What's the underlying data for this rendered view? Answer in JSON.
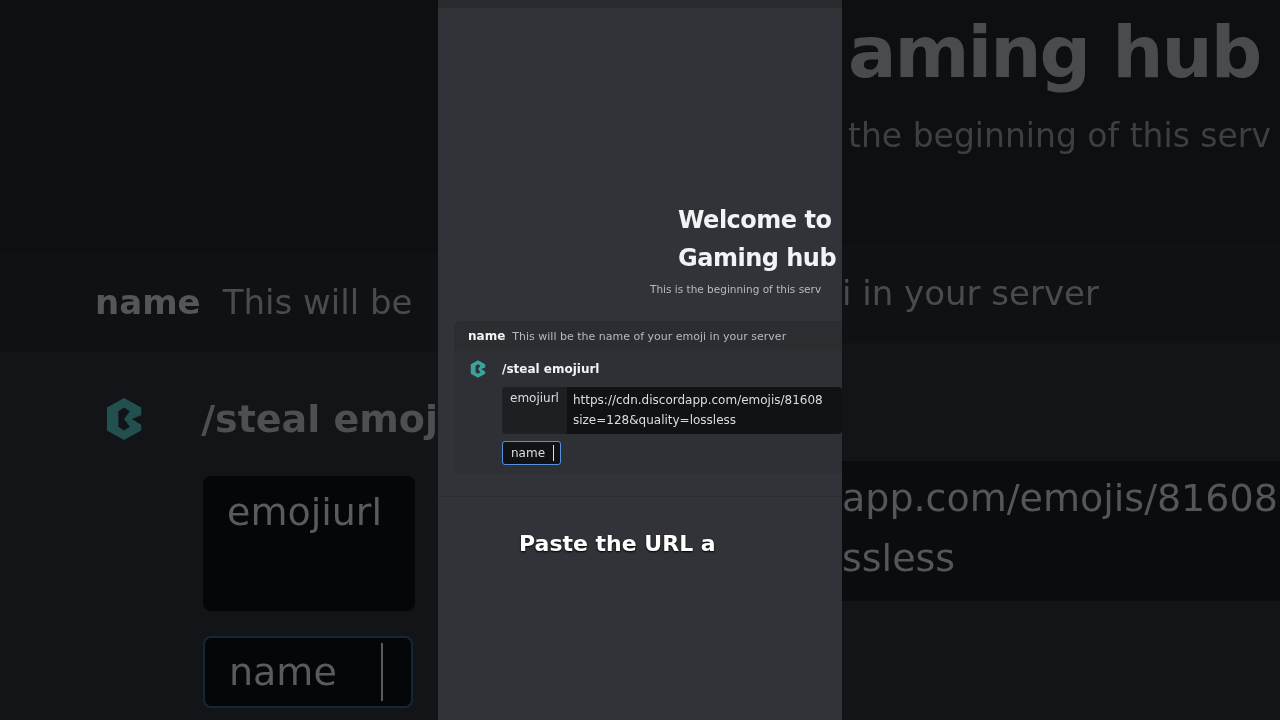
{
  "backdrop_left": {
    "hint_name": "name",
    "hint_text": "This will be",
    "command": "/steal emoj",
    "option_label": "emojiurl",
    "field_label": "name"
  },
  "backdrop_right": {
    "title": "aming hub",
    "subtitle": "the beginning of this serv",
    "hint_text": "i in your server",
    "url_lines": [
      "app.com/emojis/81608",
      "ssless"
    ]
  },
  "welcome": {
    "title_lines": [
      "Welcome to",
      "Gaming hub"
    ],
    "subtitle": "This is the beginning of this serv"
  },
  "autocomplete": {
    "hint_name": "name",
    "hint_text": "This will be the name of your emoji in your server",
    "command": "/steal emojiurl",
    "option": {
      "label": "emojiurl",
      "value_lines": [
        "https://cdn.discordapp.com/emojis/81608",
        "size=128&quality=lossless"
      ]
    },
    "field": {
      "label": "name",
      "focused": true
    }
  },
  "caption": "Paste the URL a"
}
